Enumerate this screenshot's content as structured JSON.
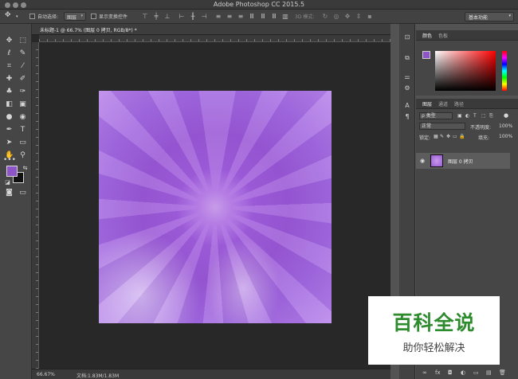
{
  "window": {
    "title": "Adobe Photoshop CC 2015.5"
  },
  "options_bar": {
    "auto_select_label": "自动选择:",
    "auto_select_value": "图层",
    "show_transform_label": "显示变换控件",
    "mode_3d_label": "3D 模式:",
    "workspace": "基本功能"
  },
  "document": {
    "tab_label": "未标题-1 @ 66.7% (图层 0 拷贝, RGB/8*) *",
    "zoom": "66.67%",
    "doc_info": "文档:1.83M/1.83M"
  },
  "colors": {
    "foreground": "#8e55c8",
    "background": "#111111",
    "artwork_base": "#9b59d6"
  },
  "color_panel": {
    "tabs": [
      "颜色",
      "色板"
    ]
  },
  "layers_panel": {
    "tabs": [
      "图层",
      "通道",
      "路径"
    ],
    "filter_label": "ρ 类型",
    "blend_mode": "正常",
    "opacity_label": "不透明度:",
    "opacity_value": "100%",
    "lock_label": "锁定:",
    "fill_label": "填充:",
    "fill_value": "100%",
    "layers": [
      {
        "name": "图层 0 拷贝"
      }
    ],
    "bottom_icons": [
      "∞",
      "fx",
      "◘",
      "◐",
      "▭",
      "▤",
      "🗑"
    ]
  },
  "watermark": {
    "title": "百科全说",
    "subtitle": "助你轻松解决"
  }
}
